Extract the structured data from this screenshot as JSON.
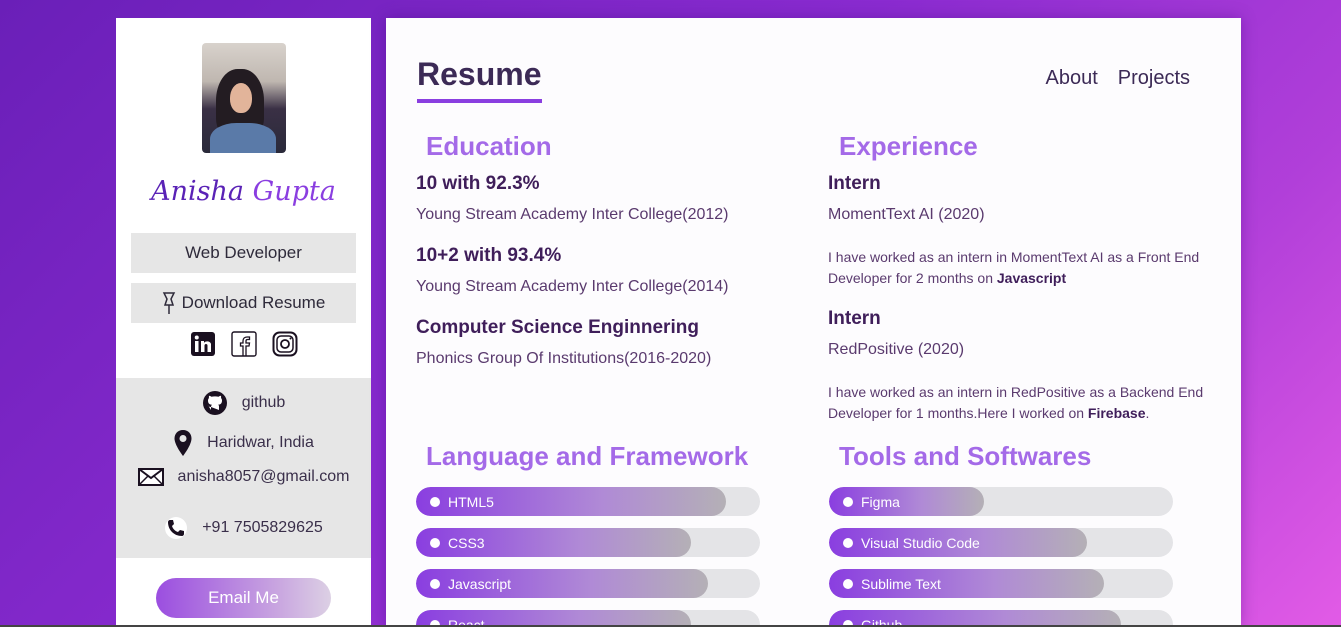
{
  "sidebar": {
    "first_name": "Anisha",
    "last_name": "Gupta",
    "role_label": "Web Developer",
    "download_label": "Download Resume",
    "social": [
      {
        "icon": "linkedin-icon"
      },
      {
        "icon": "facebook-icon"
      },
      {
        "icon": "instagram-icon"
      }
    ],
    "contact": {
      "github": "github",
      "location": "Haridwar, India",
      "email": "anisha8057@gmail.com",
      "phone": "+91 7505829625"
    },
    "email_button": "Email Me"
  },
  "main": {
    "title": "Resume",
    "nav": [
      "About",
      "Projects"
    ],
    "education": {
      "title": "Education",
      "items": [
        {
          "heading": "10 with 92.3%",
          "detail": "Young Stream Academy Inter College(2012)"
        },
        {
          "heading": "10+2 with 93.4%",
          "detail": "Young Stream Academy Inter College(2014)"
        },
        {
          "heading": "Computer Science Enginnering",
          "detail": "Phonics Group Of Institutions(2016-2020)"
        }
      ]
    },
    "experience": {
      "title": "Experience",
      "items": [
        {
          "heading": "Intern",
          "detail": "MomentText AI (2020)",
          "desc": "I have worked as an intern in MomentText AI as a Front End Developer for 2 months on ",
          "desc_bold": "Javascript",
          "desc_end": ""
        },
        {
          "heading": "Intern",
          "detail": "RedPositive (2020)",
          "desc": "I have worked as an intern in RedPositive as a Backend End Developer for 1 months.Here I worked on ",
          "desc_bold": "Firebase",
          "desc_end": "."
        }
      ]
    },
    "languages": {
      "title": "Language and Framework",
      "skills": [
        {
          "name": "HTML5",
          "level": 0.9
        },
        {
          "name": "CSS3",
          "level": 0.8
        },
        {
          "name": "Javascript",
          "level": 0.85
        },
        {
          "name": "React",
          "level": 0.8
        }
      ]
    },
    "tools": {
      "title": "Tools and Softwares",
      "skills": [
        {
          "name": "Figma",
          "level": 0.45
        },
        {
          "name": "Visual Studio Code",
          "level": 0.75
        },
        {
          "name": "Sublime Text",
          "level": 0.8
        },
        {
          "name": "Github",
          "level": 0.85
        }
      ]
    }
  },
  "colors": {
    "accent": "#8a3ee0",
    "section_title": "#a46ae8",
    "heading": "#3f1e5a"
  }
}
